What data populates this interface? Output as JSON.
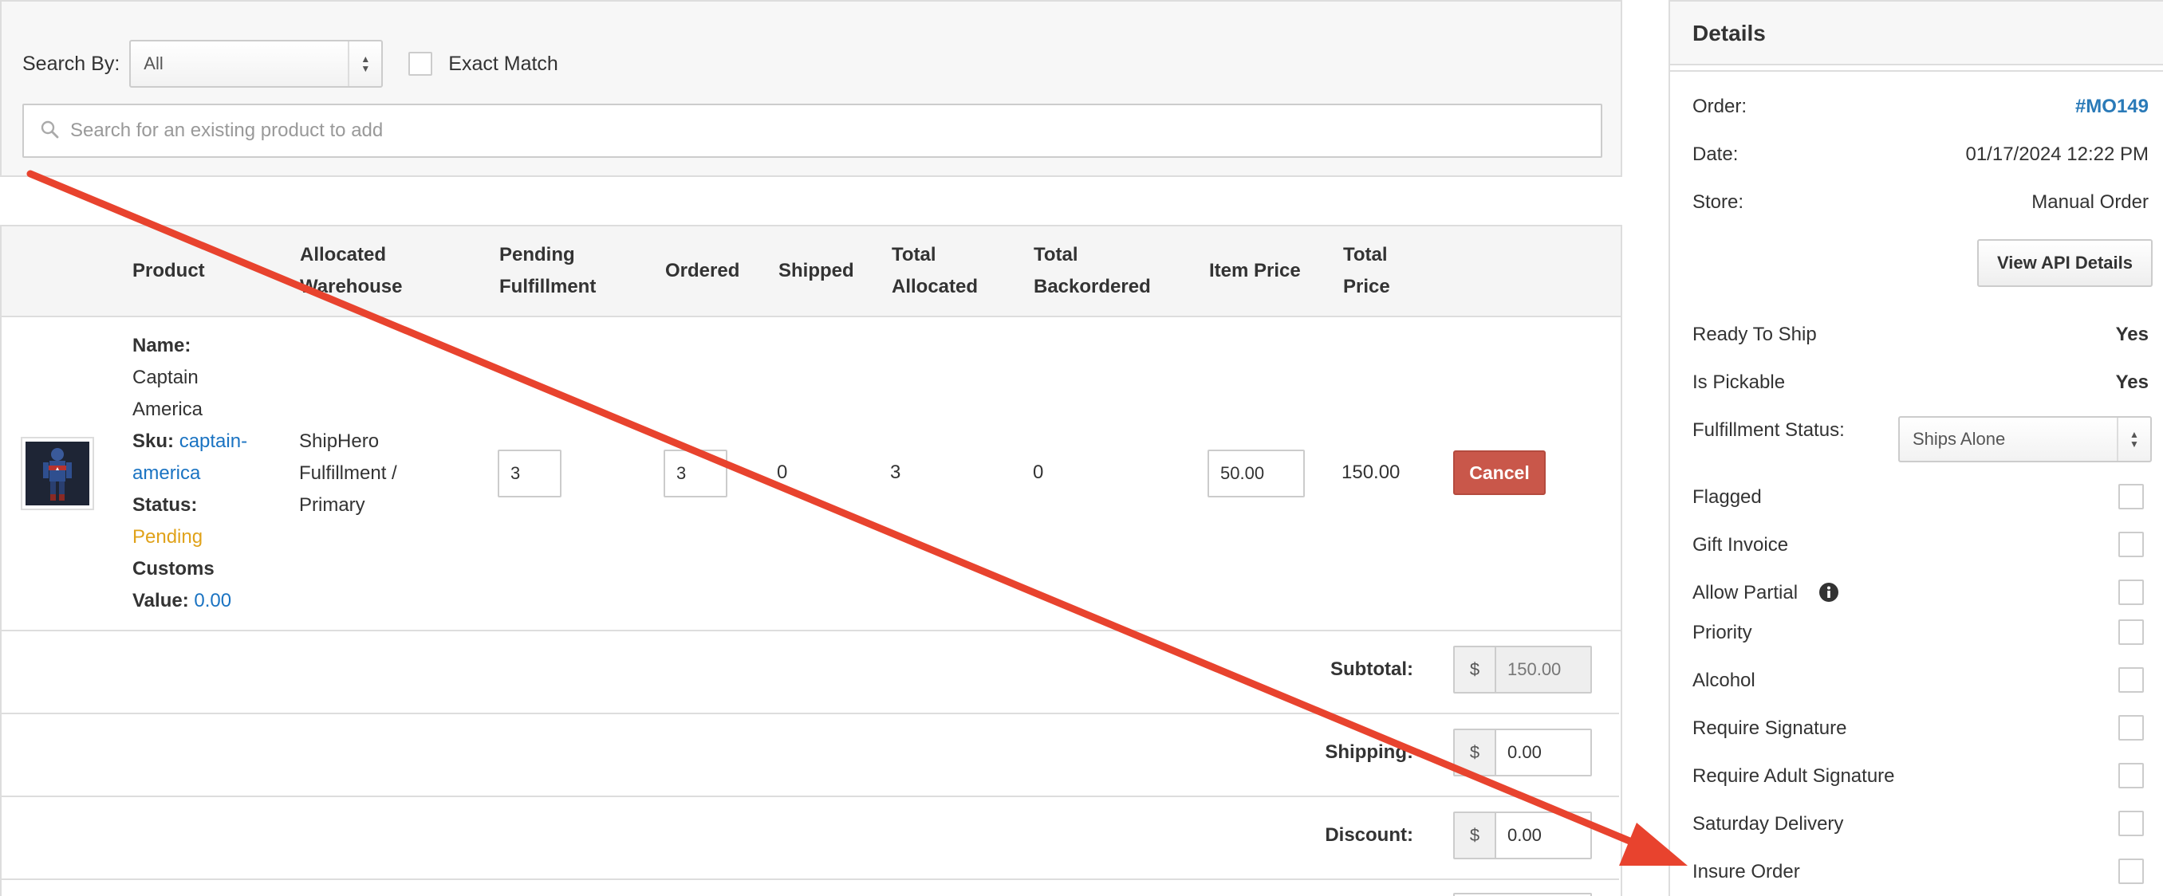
{
  "search": {
    "search_by_label": "Search By:",
    "search_by_value": "All",
    "exact_match_label": "Exact Match",
    "input_placeholder": "Search for an existing product to add"
  },
  "table": {
    "headers": {
      "product": "Product",
      "allocated_warehouse_1": "Allocated",
      "allocated_warehouse_2": "Warehouse",
      "pending_fulfillment_1": "Pending",
      "pending_fulfillment_2": "Fulfillment",
      "ordered": "Ordered",
      "shipped": "Shipped",
      "total_allocated_1": "Total",
      "total_allocated_2": "Allocated",
      "total_backordered_1": "Total",
      "total_backordered_2": "Backordered",
      "item_price": "Item Price",
      "total_price_1": "Total",
      "total_price_2": "Price"
    },
    "item": {
      "name_label": "Name:",
      "name_line1": "Captain",
      "name_line2": "America",
      "sku_label": "Sku:",
      "sku_line1": "captain-",
      "sku_line2": "america",
      "status_label": "Status:",
      "status_value": "Pending",
      "customs_label_1": "Customs",
      "customs_label_2": "Value:",
      "customs_value": "0.00",
      "warehouse_line1": "ShipHero",
      "warehouse_line2": "Fulfillment /",
      "warehouse_line3": "Primary",
      "pending_fulfillment": "3",
      "ordered": "3",
      "shipped": "0",
      "total_allocated": "3",
      "total_backordered": "0",
      "item_price": "50.00",
      "total_price": "150.00",
      "cancel_label": "Cancel"
    },
    "totals": {
      "currency": "$",
      "subtotal_label": "Subtotal:",
      "subtotal_value": "150.00",
      "shipping_label": "Shipping:",
      "shipping_value": "0.00",
      "discount_label": "Discount:",
      "discount_value": "0.00"
    }
  },
  "details": {
    "title": "Details",
    "order_label": "Order:",
    "order_value": "#MO149",
    "date_label": "Date:",
    "date_value": "01/17/2024 12:22 PM",
    "store_label": "Store:",
    "store_value": "Manual Order",
    "api_button": "View API Details",
    "ready_to_ship_label": "Ready To Ship",
    "ready_to_ship_value": "Yes",
    "is_pickable_label": "Is Pickable",
    "is_pickable_value": "Yes",
    "fulfillment_status_label": "Fulfillment Status:",
    "fulfillment_status_value": "Ships Alone",
    "flags": [
      {
        "label": "Flagged",
        "checked": false
      },
      {
        "label": "Gift Invoice",
        "checked": false
      },
      {
        "label": "Allow Partial",
        "checked": false
      },
      {
        "label": "Priority",
        "checked": false
      },
      {
        "label": "Alcohol",
        "checked": false
      },
      {
        "label": "Require Signature",
        "checked": false
      },
      {
        "label": "Require Adult Signature",
        "checked": false
      },
      {
        "label": "Saturday Delivery",
        "checked": false
      },
      {
        "label": "Insure Order",
        "checked": false
      }
    ]
  },
  "colors": {
    "accent_link": "#1a73c2",
    "order_number": "#2a7ab8",
    "cancel_button": "#c9574a",
    "status_pending": "#e0a21a",
    "annotation_arrow": "#e8432e"
  },
  "icons": {
    "search": "search-icon",
    "info": "info-icon",
    "annotation": "arrow-annotation"
  }
}
